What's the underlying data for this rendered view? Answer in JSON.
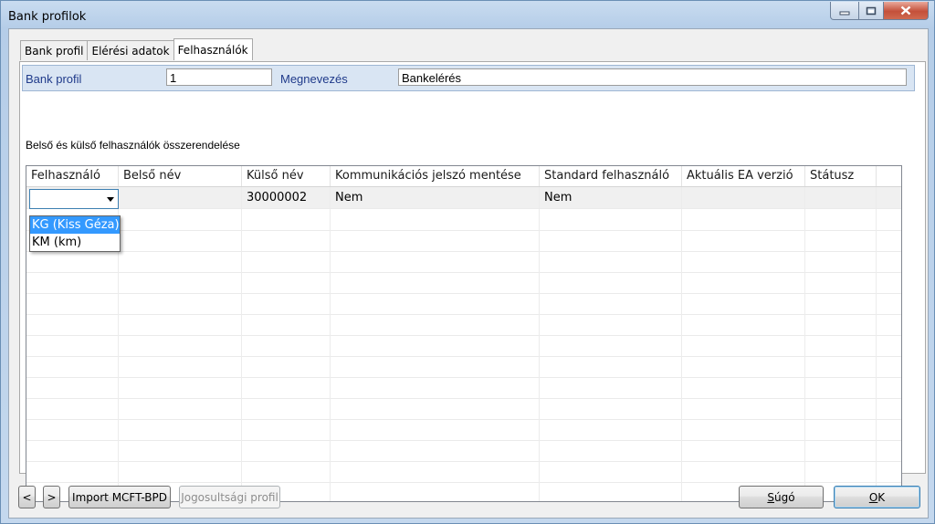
{
  "window": {
    "title": "Bank profilok"
  },
  "tabs": [
    "Bank profil",
    "Elérési adatok",
    "Felhasználók"
  ],
  "profile": {
    "bank_profil_label": "Bank profil",
    "bank_profil_value": "1",
    "megnevezes_label": "Megnevezés",
    "megnevezes_value": "Bankelérés"
  },
  "section_title": "Belső és külső felhasználók összerendelése",
  "grid": {
    "columns": [
      "Felhasználó",
      "Belső név",
      "Külső név",
      "Kommunikációs jelszó mentése",
      "Standard felhasználó",
      "Aktuális EA verzió",
      "Státusz"
    ],
    "rows": [
      {
        "felhasznalo": "",
        "belso_nev": "",
        "kulso_nev": "30000002",
        "jelszo_mentese": "Nem",
        "standard": "Nem",
        "ea_verzio": "",
        "statusz": ""
      }
    ]
  },
  "dropdown": {
    "options": [
      "KG (Kiss Géza)",
      "KM (km)"
    ],
    "highlighted": "KG (Kiss Géza)"
  },
  "buttons": {
    "prev": "<",
    "next": ">",
    "import": "Import MCFT-BPD",
    "jogosultsagi": "Jogosultsági profil",
    "sugo_u": "S",
    "sugo_rest": "úgó",
    "ok_u": "O",
    "ok_rest": "K"
  },
  "colors": {
    "accent": "#3399ff",
    "close_button": "#c4503a"
  }
}
